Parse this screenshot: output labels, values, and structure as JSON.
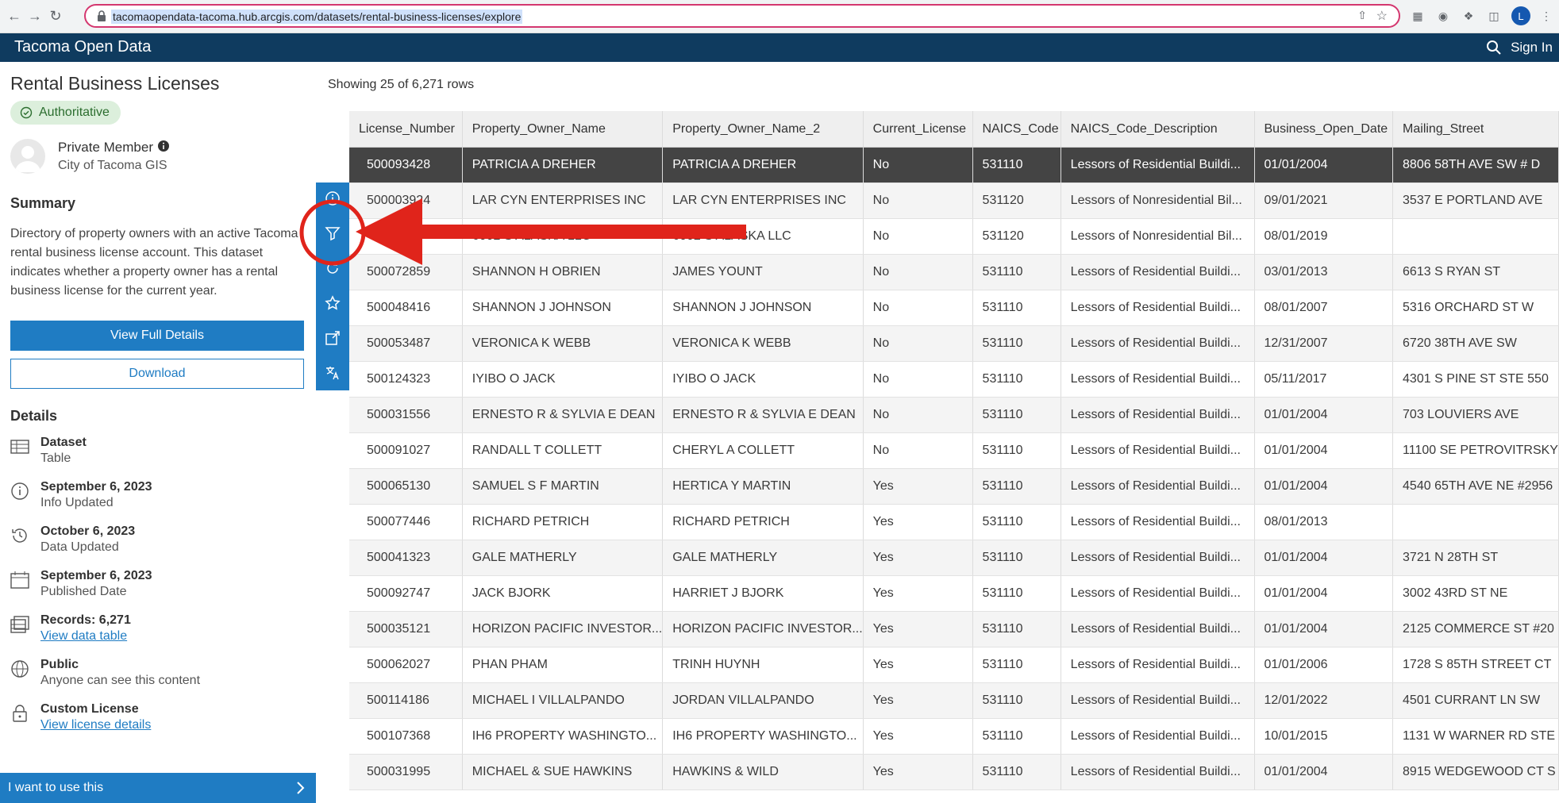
{
  "browser": {
    "url": "tacomaopendata-tacoma.hub.arcgis.com/datasets/rental-business-licenses/explore",
    "profile_initial": "L"
  },
  "site": {
    "title": "Tacoma Open Data",
    "sign_in": "Sign In"
  },
  "sidebar": {
    "title": "Rental Business Licenses",
    "badge": "Authoritative",
    "owner_type": "Private Member",
    "owner_org": "City of Tacoma GIS",
    "summary_heading": "Summary",
    "summary": "Directory of property owners with an active Tacoma rental business license account. This dataset indicates whether a property owner has a rental business license for the current year.",
    "view_full_details": "View Full Details",
    "download": "Download",
    "details_heading": "Details",
    "details": [
      {
        "icon": "table-icon",
        "title": "Dataset",
        "sub": "Table"
      },
      {
        "icon": "info-icon",
        "title": "September 6, 2023",
        "sub": "Info Updated"
      },
      {
        "icon": "history-icon",
        "title": "October 6, 2023",
        "sub": "Data Updated"
      },
      {
        "icon": "calendar-icon",
        "title": "September 6, 2023",
        "sub": "Published Date"
      },
      {
        "icon": "records-icon",
        "title": "Records: 6,271",
        "link": "View data table"
      },
      {
        "icon": "globe-icon",
        "title": "Public",
        "sub": "Anyone can see this content"
      },
      {
        "icon": "lock-icon",
        "title": "Custom License",
        "link": "View license details"
      }
    ],
    "use_this": "I want to use this"
  },
  "table": {
    "row_count": "Showing 25 of 6,271 rows",
    "columns": [
      "License_Number",
      "Property_Owner_Name",
      "Property_Owner_Name_2",
      "Current_License",
      "NAICS_Code",
      "NAICS_Code_Description",
      "Business_Open_Date",
      "Mailing_Street"
    ],
    "rows": [
      [
        "500093428",
        "PATRICIA A DREHER",
        "PATRICIA A DREHER",
        "No",
        "531110",
        "Lessors of Residential Buildi...",
        "01/01/2004",
        "8806 58TH AVE SW # D"
      ],
      [
        "500003924",
        "LAR CYN ENTERPRISES INC",
        "LAR CYN ENTERPRISES INC",
        "No",
        "531120",
        "Lessors of Nonresidential Bil...",
        "09/01/2021",
        "3537 E PORTLAND AVE"
      ],
      [
        "",
        "6002 S ALASKA LLC",
        "6002 S ALASKA LLC",
        "No",
        "531120",
        "Lessors of Nonresidential Bil...",
        "08/01/2019",
        ""
      ],
      [
        "500072859",
        "SHANNON H OBRIEN",
        "JAMES YOUNT",
        "No",
        "531110",
        "Lessors of Residential Buildi...",
        "03/01/2013",
        "6613 S RYAN ST"
      ],
      [
        "500048416",
        "SHANNON J JOHNSON",
        "SHANNON J JOHNSON",
        "No",
        "531110",
        "Lessors of Residential Buildi...",
        "08/01/2007",
        "5316 ORCHARD ST W"
      ],
      [
        "500053487",
        "VERONICA K WEBB",
        "VERONICA K WEBB",
        "No",
        "531110",
        "Lessors of Residential Buildi...",
        "12/31/2007",
        "6720 38TH AVE SW"
      ],
      [
        "500124323",
        "IYIBO O JACK",
        "IYIBO O JACK",
        "No",
        "531110",
        "Lessors of Residential Buildi...",
        "05/11/2017",
        "4301 S PINE ST STE 550"
      ],
      [
        "500031556",
        "ERNESTO R & SYLVIA E DEAN",
        "ERNESTO R & SYLVIA E DEAN",
        "No",
        "531110",
        "Lessors of Residential Buildi...",
        "01/01/2004",
        "703 LOUVIERS AVE"
      ],
      [
        "500091027",
        "RANDALL T COLLETT",
        "CHERYL A COLLETT",
        "No",
        "531110",
        "Lessors of Residential Buildi...",
        "01/01/2004",
        "11100 SE PETROVITRSKY"
      ],
      [
        "500065130",
        "SAMUEL S F MARTIN",
        "HERTICA Y MARTIN",
        "Yes",
        "531110",
        "Lessors of Residential Buildi...",
        "01/01/2004",
        "4540 65TH AVE NE #2956"
      ],
      [
        "500077446",
        "RICHARD PETRICH",
        "RICHARD PETRICH",
        "Yes",
        "531110",
        "Lessors of Residential Buildi...",
        "08/01/2013",
        ""
      ],
      [
        "500041323",
        "GALE MATHERLY",
        "GALE MATHERLY",
        "Yes",
        "531110",
        "Lessors of Residential Buildi...",
        "01/01/2004",
        "3721 N 28TH ST"
      ],
      [
        "500092747",
        "JACK BJORK",
        "HARRIET J BJORK",
        "Yes",
        "531110",
        "Lessors of Residential Buildi...",
        "01/01/2004",
        "3002 43RD ST NE"
      ],
      [
        "500035121",
        "HORIZON PACIFIC INVESTOR...",
        "HORIZON PACIFIC INVESTOR...",
        "Yes",
        "531110",
        "Lessors of Residential Buildi...",
        "01/01/2004",
        "2125 COMMERCE ST #20"
      ],
      [
        "500062027",
        "PHAN PHAM",
        "TRINH HUYNH",
        "Yes",
        "531110",
        "Lessors of Residential Buildi...",
        "01/01/2006",
        "1728 S 85TH STREET CT"
      ],
      [
        "500114186",
        "MICHAEL I VILLALPANDO",
        "JORDAN VILLALPANDO",
        "Yes",
        "531110",
        "Lessors of Residential Buildi...",
        "12/01/2022",
        "4501 CURRANT LN SW"
      ],
      [
        "500107368",
        "IH6 PROPERTY WASHINGTO...",
        "IH6 PROPERTY WASHINGTO...",
        "Yes",
        "531110",
        "Lessors of Residential Buildi...",
        "10/01/2015",
        "1131 W WARNER RD STE"
      ],
      [
        "500031995",
        "MICHAEL & SUE HAWKINS",
        "HAWKINS & WILD",
        "Yes",
        "531110",
        "Lessors of Residential Buildi...",
        "01/01/2004",
        "8915 WEDGEWOOD CT S"
      ]
    ]
  },
  "toolbar": [
    "info-icon",
    "filter-icon",
    "refresh-icon",
    "star-icon",
    "share-icon",
    "translate-icon"
  ],
  "colors": {
    "header_bg": "#0f3b5f",
    "accent": "#1f7cc3",
    "annotation": "#e0241b"
  }
}
